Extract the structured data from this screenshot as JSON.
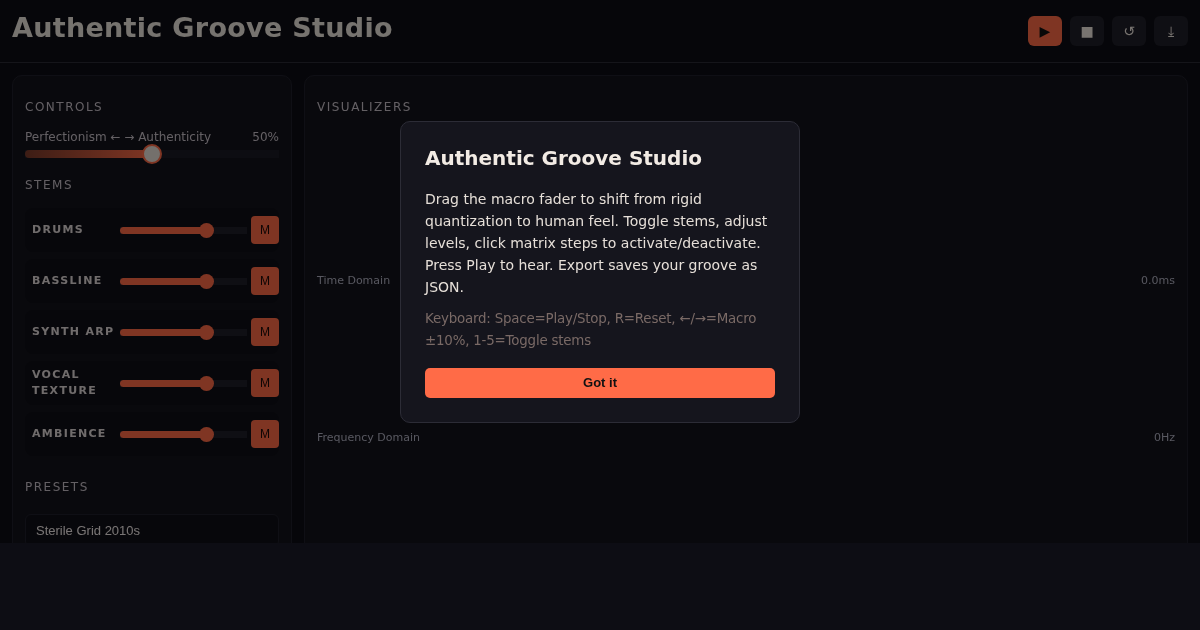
{
  "header": {
    "title": "Authentic Groove Studio",
    "buttons": [
      {
        "kind": "play",
        "label": "▶"
      },
      {
        "kind": "stop",
        "label": "■"
      },
      {
        "kind": "reset",
        "label": "↺"
      },
      {
        "kind": "export",
        "label": "⤓"
      }
    ]
  },
  "controls": {
    "heading": "CONTROLS",
    "macro": {
      "label": "Perfectionism ← → Authenticity",
      "reading": "50%",
      "level": 0.5
    },
    "stems_heading": "STEMS",
    "stems": [
      {
        "name": "DRUMS",
        "level": 0.68,
        "muted": false,
        "mute_label": "M"
      },
      {
        "name": "BASSLINE",
        "level": 0.68,
        "muted": false,
        "mute_label": "M"
      },
      {
        "name": "SYNTH ARP",
        "level": 0.68,
        "muted": false,
        "mute_label": "M"
      },
      {
        "name": "VOCAL TEXTURE",
        "level": 0.68,
        "muted": false,
        "mute_label": "M"
      },
      {
        "name": "AMBIENCE",
        "level": 0.68,
        "muted": false,
        "mute_label": "M"
      }
    ],
    "presets_heading": "PRESETS",
    "presets": [
      "Sterile Grid 2010s"
    ]
  },
  "visualizers": {
    "heading": "VISUALIZERS",
    "views": [
      {
        "label": "Time Domain",
        "reading": "0.0ms"
      },
      {
        "label": "Frequency Domain",
        "reading": "0Hz"
      }
    ]
  },
  "dialog": {
    "title": "Authentic Groove Studio",
    "body": "Drag the macro fader to shift from rigid quantization to human feel. Toggle stems, adjust levels, click matrix steps to activate/deactivate. Press Play to hear. Export saves your groove as JSON.",
    "hint": "Keyboard: Space=Play/Stop, R=Reset, ←/→=Macro ±10%, 1-5=Toggle stems",
    "button": "Got it"
  }
}
